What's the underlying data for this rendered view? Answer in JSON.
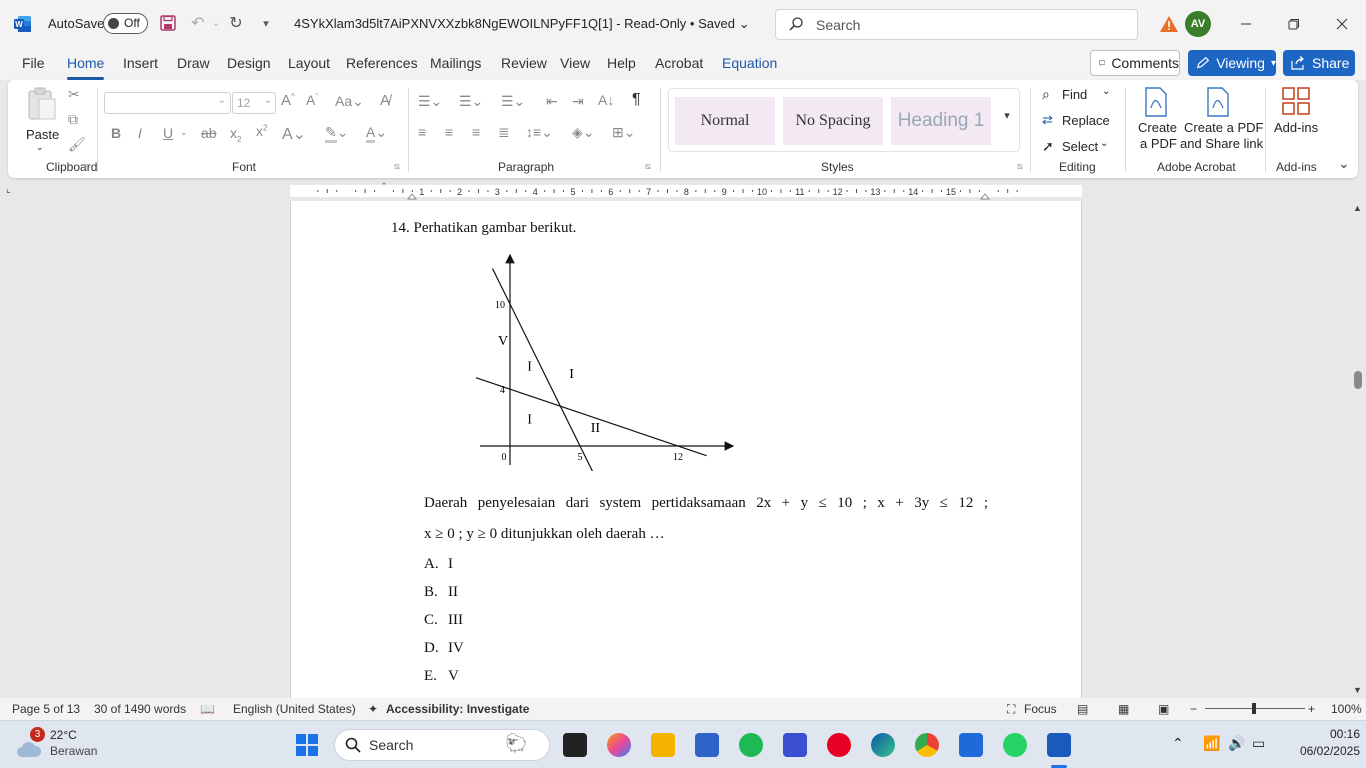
{
  "titlebar": {
    "autosave_label": "AutoSave",
    "autosave_state": "Off",
    "doc_title": "4SYkXlam3d5lt7AiPXNVXXzbk8NgEWOILNPyFF1Q[1]  -  Read-Only • Saved",
    "search_placeholder": "Search",
    "avatar_initials": "AV"
  },
  "ribbon_tabs": [
    "File",
    "Home",
    "Insert",
    "Draw",
    "Design",
    "Layout",
    "References",
    "Mailings",
    "Review",
    "View",
    "Help",
    "Acrobat",
    "Equation"
  ],
  "ribbon_actions": {
    "comments": "Comments",
    "viewing": "Viewing",
    "share": "Share"
  },
  "ribbon": {
    "clipboard": {
      "paste": "Paste",
      "label": "Clipboard"
    },
    "font": {
      "size": "12",
      "label": "Font"
    },
    "paragraph": {
      "label": "Paragraph"
    },
    "styles": {
      "items": [
        "Normal",
        "No Spacing",
        "Heading 1"
      ],
      "label": "Styles"
    },
    "editing": {
      "find": "Find",
      "replace": "Replace",
      "select": "Select",
      "label": "Editing"
    },
    "acrobat": {
      "create_pdf": "Create\na PDF",
      "create_pdf_line1": "Create",
      "create_pdf_line2": "a PDF",
      "share_pdf_line1": "Create a PDF",
      "share_pdf_line2": "and Share link",
      "label": "Adobe Acrobat"
    },
    "addins": {
      "button": "Add-ins",
      "label": "Add-ins"
    }
  },
  "ruler_numbers": [
    "1",
    "2",
    "3",
    "4",
    "5",
    "6",
    "7",
    "8",
    "9",
    "10",
    "11",
    "12",
    "13",
    "14",
    "15"
  ],
  "document": {
    "question_title": "14. Perhatikan gambar berikut.",
    "paragraph_line1": "Daerah   penyelesaian   dari   system   pertidaksamaan   2x + y ≤ 10 ;   x + 3y ≤ 12 ;",
    "paragraph_line2": "x ≥ 0 ; y ≥ 0 ditunjukkan oleh daerah …",
    "options": [
      {
        "letter": "A.",
        "text": "I"
      },
      {
        "letter": "B.",
        "text": "II"
      },
      {
        "letter": "C.",
        "text": "III"
      },
      {
        "letter": "D.",
        "text": "IV"
      },
      {
        "letter": "E.",
        "text": "V"
      }
    ]
  },
  "chart_data": {
    "type": "line",
    "x_ticks": [
      "0",
      "5",
      "12"
    ],
    "y_ticks": [
      "10",
      "4"
    ],
    "lines": [
      {
        "equation": "2x + y = 10",
        "points": [
          [
            0,
            10
          ],
          [
            5,
            0
          ]
        ]
      },
      {
        "equation": "x + 3y = 12",
        "points": [
          [
            0,
            4
          ],
          [
            12,
            0
          ]
        ]
      }
    ],
    "region_labels": [
      "V",
      "I",
      "I",
      "I",
      "II"
    ]
  },
  "statusbar": {
    "page": "Page 5 of 13",
    "words": "30 of 1490 words",
    "language": "English (United States)",
    "accessibility": "Accessibility: Investigate",
    "focus": "Focus",
    "zoom": "100%"
  },
  "taskbar": {
    "weather_temp": "22°C",
    "weather_desc": "Berawan",
    "weather_badge": "3",
    "search": "Search",
    "time": "00:16",
    "date": "06/02/2025"
  },
  "colors": {
    "accent": "#1e66c4",
    "word_blue": "#185abd",
    "avatar": "#3a7d2c"
  }
}
